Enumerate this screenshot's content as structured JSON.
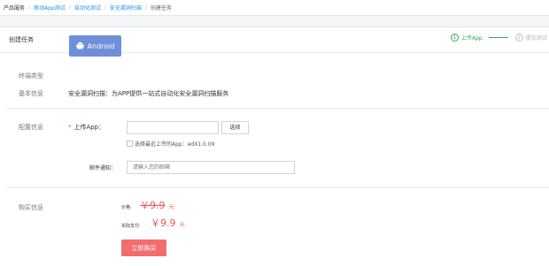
{
  "breadcrumb": [
    {
      "label": "产品服务",
      "type": "plain"
    },
    {
      "label": "移动App测试",
      "type": "link"
    },
    {
      "label": "自动化测试",
      "type": "link"
    },
    {
      "label": "安全漏洞扫描",
      "type": "link"
    },
    {
      "label": "创建任务",
      "type": "current"
    }
  ],
  "card": {
    "title": "创建任务",
    "steps": [
      {
        "number": "1",
        "label": "上传App",
        "state": "active"
      },
      {
        "number": "2",
        "label": "提交测试",
        "state": "inactive"
      }
    ]
  },
  "terminal": {
    "label": "终端类型",
    "button": "Android",
    "icon": "android-icon"
  },
  "basic": {
    "label": "基本信息",
    "text": "安全漏洞扫描：为APP提供一站式自动化安全漏洞扫描服务"
  },
  "config": {
    "label": "配置信息",
    "upload_label": "上传App：",
    "upload_value": "",
    "select_button": "选择",
    "recent_checkbox_label": "选择最近上传的App：edX1.0.09",
    "recent_checked": false,
    "email_label": "邮件通知：",
    "email_placeholder": "请输入您的邮箱"
  },
  "purchase": {
    "label": "购买信息",
    "price_label": "价格:",
    "price": "￥9.9",
    "actual_label": "实际支付:",
    "actual_price": "￥9.9",
    "unit": "元",
    "buy_button": "立即购买"
  },
  "colors": {
    "accent_green": "#34a853",
    "link_blue": "#1f8fe5",
    "price_red": "#f05454",
    "android_blue": "#6f8fd8",
    "buy_red": "#f36d6d"
  }
}
